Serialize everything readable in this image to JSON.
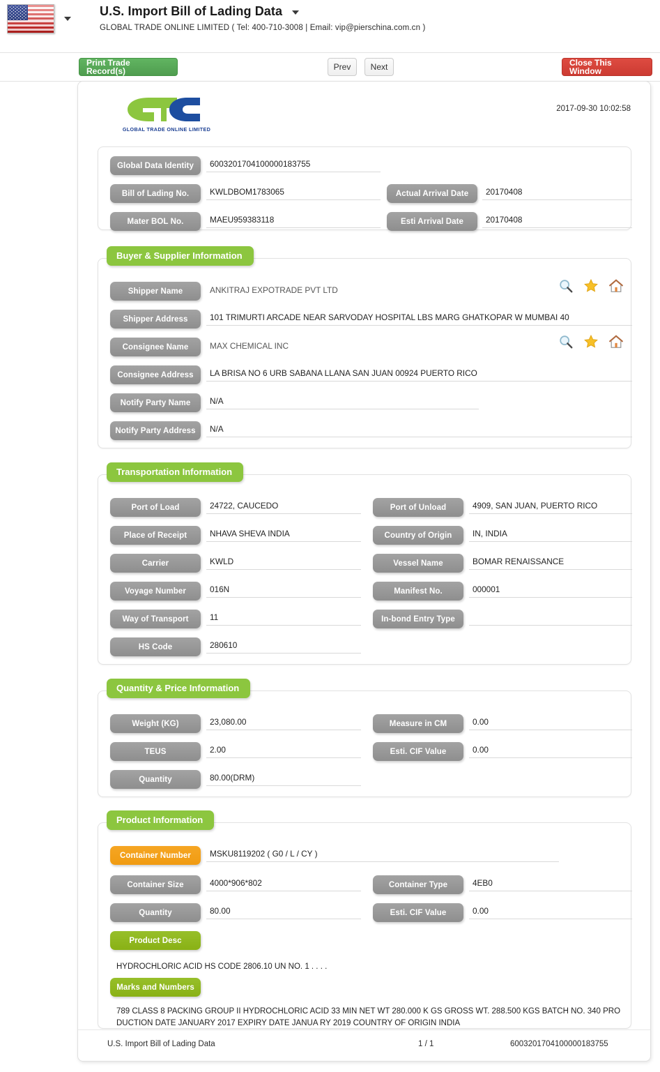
{
  "header": {
    "flag_icon": "us-flag-icon",
    "title": "U.S. Import Bill of Lading Data",
    "subtitle": "GLOBAL TRADE ONLINE LIMITED ( Tel: 400-710-3008 | Email: vip@pierschina.com.cn )"
  },
  "toolbar": {
    "print_label": "Print Trade Record(s)",
    "prev_label": "Prev",
    "next_label": "Next",
    "close_label": "Close This Window"
  },
  "document": {
    "logo_text": "GLOBAL TRADE  ONLINE LIMITED",
    "timestamp": "2017-09-30 10:02:58"
  },
  "identity": {
    "fields": [
      {
        "label": "Global Data Identity",
        "value": "6003201704100000183755"
      },
      {
        "label": "Bill of Lading No.",
        "value": "KWLDBOM1783065"
      },
      {
        "label": "Actual Arrival Date",
        "value": "20170408"
      },
      {
        "label": "Mater BOL No.",
        "value": "MAEU959383118"
      },
      {
        "label": "Esti Arrival Date",
        "value": "20170408"
      }
    ]
  },
  "buyer_supplier": {
    "title": "Buyer & Supplier Information",
    "fields": [
      {
        "label": "Shipper Name",
        "value": "ANKITRAJ EXPOTRADE PVT LTD"
      },
      {
        "label": "Shipper Address",
        "value": "101 TRIMURTI ARCADE NEAR SARVODAY HOSPITAL LBS MARG GHATKOPAR W MUMBAI 40"
      },
      {
        "label": "Consignee Name",
        "value": "MAX CHEMICAL INC"
      },
      {
        "label": "Consignee Address",
        "value": "LA BRISA NO 6 URB SABANA LLANA SAN JUAN 00924 PUERTO RICO"
      },
      {
        "label": "Notify Party Name",
        "value": "N/A"
      },
      {
        "label": "Notify Party Address",
        "value": "N/A"
      }
    ],
    "actions": [
      "search-icon",
      "star-icon",
      "home-icon"
    ]
  },
  "transportation": {
    "title": "Transportation Information",
    "fields": [
      {
        "label": "Port of Load",
        "value": "24722, CAUCEDO"
      },
      {
        "label": "Port of Unload",
        "value": "4909, SAN JUAN, PUERTO RICO"
      },
      {
        "label": "Place of Receipt",
        "value": "NHAVA SHEVA INDIA"
      },
      {
        "label": "Country of Origin",
        "value": "IN, INDIA"
      },
      {
        "label": "Carrier",
        "value": "KWLD"
      },
      {
        "label": "Vessel Name",
        "value": "BOMAR RENAISSANCE"
      },
      {
        "label": "Voyage Number",
        "value": "016N"
      },
      {
        "label": "Manifest No.",
        "value": "000001"
      },
      {
        "label": "Way of Transport",
        "value": "11"
      },
      {
        "label": "In-bond Entry Type",
        "value": ""
      },
      {
        "label": "HS Code",
        "value": "280610"
      }
    ]
  },
  "quantity_price": {
    "title": "Quantity & Price Information",
    "fields": [
      {
        "label": "Weight (KG)",
        "value": "23,080.00"
      },
      {
        "label": "Measure in CM",
        "value": "0.00"
      },
      {
        "label": "TEUS",
        "value": "2.00"
      },
      {
        "label": "Esti. CIF Value",
        "value": "0.00"
      },
      {
        "label": "Quantity",
        "value": "80.00(DRM)"
      }
    ]
  },
  "product": {
    "title": "Product Information",
    "container_number_label": "Container Number",
    "container_number_value": "MSKU8119202 ( G0 / L / CY )",
    "fields": [
      {
        "label": "Container Size",
        "value": "4000*906*802"
      },
      {
        "label": "Container Type",
        "value": "4EB0"
      },
      {
        "label": "Quantity",
        "value": "80.00"
      },
      {
        "label": "Esti. CIF Value",
        "value": "0.00"
      }
    ],
    "product_desc_label": "Product Desc",
    "product_desc_value": "HYDROCHLORIC ACID HS CODE 2806.10 UN NO. 1 . . . .",
    "marks_label": "Marks and Numbers",
    "marks_value": "789 CLASS 8 PACKING GROUP II HYDROCHLORIC ACID 33 MIN NET WT 280.000 K GS GROSS WT. 288.500 KGS BATCH NO. 340 PRO\nDUCTION DATE JANUARY 2017 EXPIRY DATE JANUA RY 2019 COUNTRY OF ORIGIN INDIA"
  },
  "footer": {
    "left": "U.S. Import Bill of Lading Data",
    "page": "1 / 1",
    "right": "6003201704100000183755"
  },
  "colors": {
    "section_green": "#8cc63f",
    "pill_green": "#8fb81c",
    "pill_orange": "#f5a623",
    "pill_gray": "#9a9a9a",
    "print_green": "#55a555",
    "close_red": "#d24436",
    "logo_green": "#8cc63f",
    "logo_blue": "#1b3f93"
  }
}
